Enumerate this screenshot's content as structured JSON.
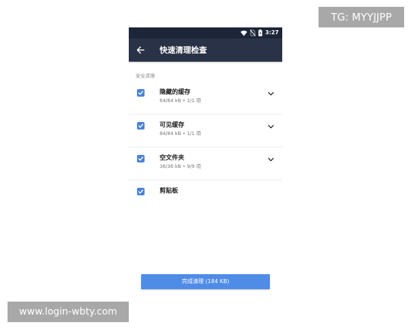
{
  "status_bar": {
    "time": "3:27",
    "icons": [
      "wifi-icon",
      "no-sim-icon",
      "battery-icon"
    ]
  },
  "app_bar": {
    "back_icon": "arrow-back-icon",
    "title": "快速清理检查"
  },
  "section": {
    "header": "安全清理"
  },
  "items": [
    {
      "title": "隐藏的缓存",
      "subtitle": "64/64 kB • 1/1 项",
      "checked": true,
      "expandable": true
    },
    {
      "title": "可见缓存",
      "subtitle": "84/84 kB • 1/1 项",
      "checked": true,
      "expandable": true
    },
    {
      "title": "空文件夹",
      "subtitle": "36/36 kB • 9/9 项",
      "checked": true,
      "expandable": true
    },
    {
      "title": "剪贴板",
      "subtitle": "",
      "checked": true,
      "expandable": false
    }
  ],
  "done_button": {
    "label": "完成清理 (184 KB)"
  },
  "overlays": {
    "tg": "TG: MYYJJPP",
    "site": "www.login-wbty.com"
  },
  "colors": {
    "status_bar": "#1d2538",
    "app_bar": "#2a3247",
    "checkbox": "#4d82d6",
    "button": "#4f8ce7",
    "overlay": "#a8a8a8"
  }
}
